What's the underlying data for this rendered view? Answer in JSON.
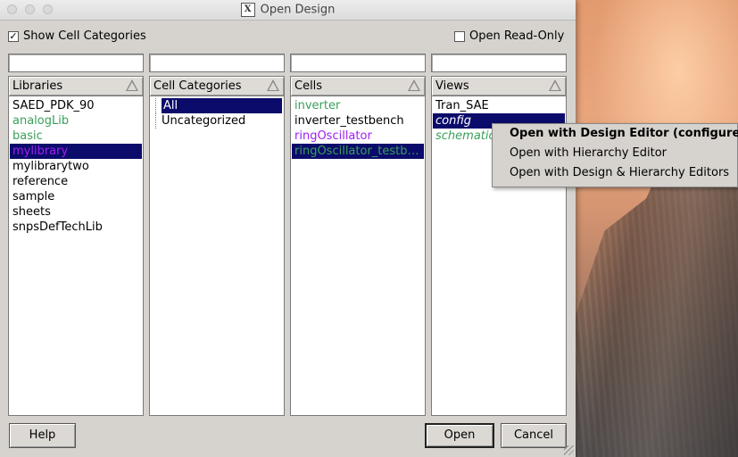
{
  "window": {
    "title": "Open Design"
  },
  "options": {
    "show_cell_categories": {
      "label": "Show Cell Categories",
      "checked": true
    },
    "open_read_only": {
      "label": "Open Read-Only",
      "checked": false
    }
  },
  "filters": {
    "libraries": "",
    "cell_categories": "",
    "cells": "",
    "views": ""
  },
  "panels": {
    "libraries": {
      "header": "Libraries",
      "items": [
        {
          "label": "SAED_PDK_90",
          "color": "#000000"
        },
        {
          "label": "analogLib",
          "color": "#3aa05a"
        },
        {
          "label": "basic",
          "color": "#3aa05a"
        },
        {
          "label": "mylibrary",
          "color": "#a020f0",
          "selected": true
        },
        {
          "label": "mylibrarytwo",
          "color": "#000000"
        },
        {
          "label": "reference",
          "color": "#000000"
        },
        {
          "label": "sample",
          "color": "#000000"
        },
        {
          "label": "sheets",
          "color": "#000000"
        },
        {
          "label": "snpsDefTechLib",
          "color": "#000000"
        }
      ]
    },
    "cell_categories": {
      "header": "Cell Categories",
      "items": [
        {
          "label": "All",
          "selected": true
        },
        {
          "label": "Uncategorized"
        }
      ]
    },
    "cells": {
      "header": "Cells",
      "items": [
        {
          "label": "inverter",
          "color": "#3aa05a"
        },
        {
          "label": "inverter_testbench",
          "color": "#000000"
        },
        {
          "label": "ringOscillator",
          "color": "#a020f0"
        },
        {
          "label": "ringOscillator_testb…",
          "color": "#3aa05a",
          "selected": true
        }
      ]
    },
    "views": {
      "header": "Views",
      "items": [
        {
          "label": "Tran_SAE",
          "color": "#000000"
        },
        {
          "label": "config",
          "color": "#ffffff",
          "selected": true,
          "italic": true
        },
        {
          "label": "schematic",
          "color": "#3aa05a",
          "italic": true
        }
      ]
    }
  },
  "buttons": {
    "help": "Help",
    "open": "Open",
    "cancel": "Cancel"
  },
  "context_menu": {
    "items": [
      {
        "label": "Open with Design Editor (configured)",
        "bold": true
      },
      {
        "label": "Open with Hierarchy Editor"
      },
      {
        "label": "Open with Design & Hierarchy Editors"
      }
    ]
  },
  "colors": {
    "selection": "#0b0b6b",
    "window_bg": "#d6d3ce"
  }
}
